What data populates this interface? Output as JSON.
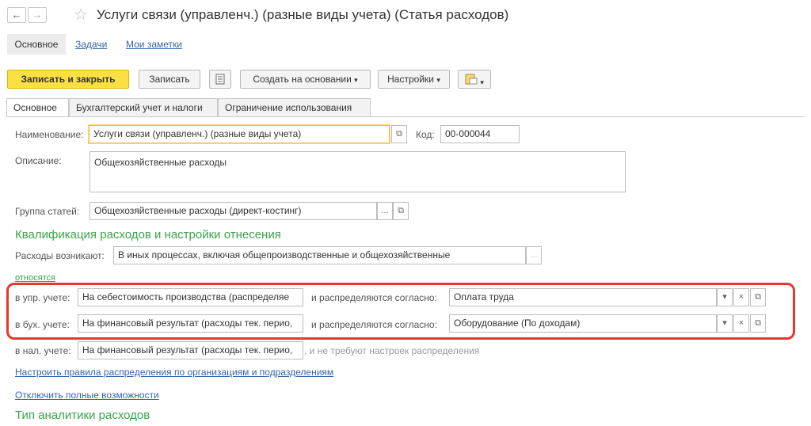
{
  "window": {
    "title": "Услуги связи (управленч.) (разные виды учета) (Статья расходов)"
  },
  "nav": {
    "back": "←",
    "forward": "→",
    "star": "☆"
  },
  "top_tabs": {
    "main": "Основное",
    "tasks": "Задачи",
    "notes": "Мои заметки"
  },
  "toolbar": {
    "save_close": "Записать и закрыть",
    "save": "Записать",
    "create_based": "Создать на основании",
    "settings": "Настройки",
    "dropdown_glyph": "▾"
  },
  "tabs": {
    "main": "Основное",
    "accounting": "Бухгалтерский учет и налоги",
    "restriction": "Ограничение использования"
  },
  "form": {
    "name_label": "Наименование:",
    "name_value": "Услуги связи (управленч.) (разные виды учета)",
    "code_label": "Код:",
    "code_value": "00-000044",
    "description_label": "Описание:",
    "description_value": "Общехозяйственные расходы",
    "group_label": "Группа статей:",
    "group_value": "Общехозяйственные расходы (директ-костинг)",
    "section_title": "Квалификация расходов и настройки отнесения",
    "expenses_arise_label": "Расходы возникают:",
    "expenses_arise_value": "В иных процессах, включая общепроизводственные и общехозяйственные",
    "relate_label": "относятся",
    "mgmt_label": "в упр. учете:",
    "mgmt_value": "На себестоимость производства (распределяе",
    "mgmt_dist_label": "и распределяются согласно:",
    "mgmt_dist_value": "Оплата труда",
    "acc_label": "в бух. учете:",
    "acc_value": "На финансовый результат (расходы тек. перио,",
    "acc_dist_label": "и распределяются согласно:",
    "acc_dist_value": "Оборудование (По доходам)",
    "tax_label": "в нал. учете:",
    "tax_value": "На финансовый результат (расходы тек. перио,",
    "tax_note": ", и не требуют настроек распределения",
    "link_rules": "Настроить правила распределения по организациям и подразделениям",
    "link_disable": "Отключить полные возможности",
    "analytics_title": "Тип аналитики расходов"
  },
  "icons": {
    "open": "⧉",
    "choose": "...",
    "clear": "×",
    "dropdown": "▾"
  },
  "colors": {
    "primary_button": "#fbe044",
    "section_green": "#3aa34a",
    "link_blue": "#3466a8",
    "highlight_red": "#e5382f"
  }
}
